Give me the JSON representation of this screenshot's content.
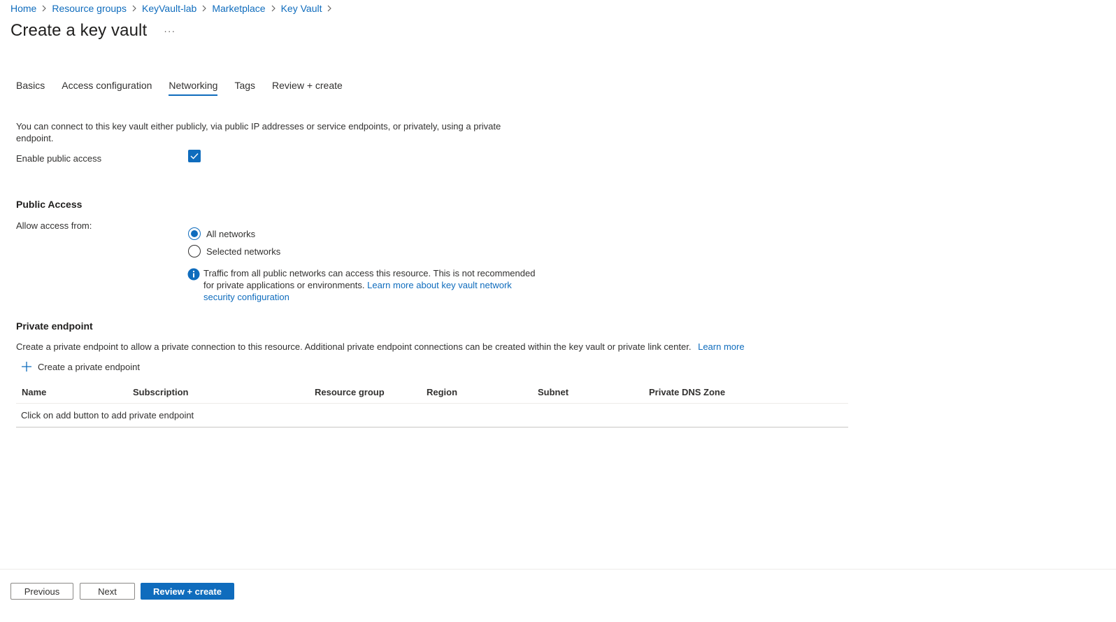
{
  "breadcrumb": [
    {
      "label": "Home"
    },
    {
      "label": "Resource groups"
    },
    {
      "label": "KeyVault-lab"
    },
    {
      "label": "Marketplace"
    },
    {
      "label": "Key Vault"
    }
  ],
  "page": {
    "title": "Create a key vault",
    "more_label": "···"
  },
  "tabs": [
    {
      "label": "Basics",
      "active": false
    },
    {
      "label": "Access configuration",
      "active": false
    },
    {
      "label": "Networking",
      "active": true
    },
    {
      "label": "Tags",
      "active": false
    },
    {
      "label": "Review + create",
      "active": false
    }
  ],
  "networking": {
    "intro": "You can connect to this key vault either publicly, via public IP addresses or service endpoints, or privately, using a private endpoint.",
    "enable_public_access_label": "Enable public access",
    "enable_public_access_checked": true
  },
  "public_access": {
    "title": "Public Access",
    "allow_from_label": "Allow access from:",
    "options": [
      {
        "label": "All networks",
        "selected": true
      },
      {
        "label": "Selected networks",
        "selected": false
      }
    ],
    "info_text": "Traffic from all public networks can access this resource. This is not recommended for private applications or environments.",
    "info_link": "Learn more about key vault network security configuration"
  },
  "private_endpoint": {
    "title": "Private endpoint",
    "description": "Create a private endpoint to allow a private connection to this resource. Additional private endpoint connections can be created within the key vault or private link center.",
    "learn_more": "Learn more",
    "add_label": "Create a private endpoint",
    "columns": [
      "Name",
      "Subscription",
      "Resource group",
      "Region",
      "Subnet",
      "Private DNS Zone"
    ],
    "empty_message": "Click on add button to add private endpoint"
  },
  "footer": {
    "previous": "Previous",
    "next": "Next",
    "review_create": "Review + create"
  },
  "colors": {
    "accent": "#0f6cbd",
    "text": "#323130"
  }
}
